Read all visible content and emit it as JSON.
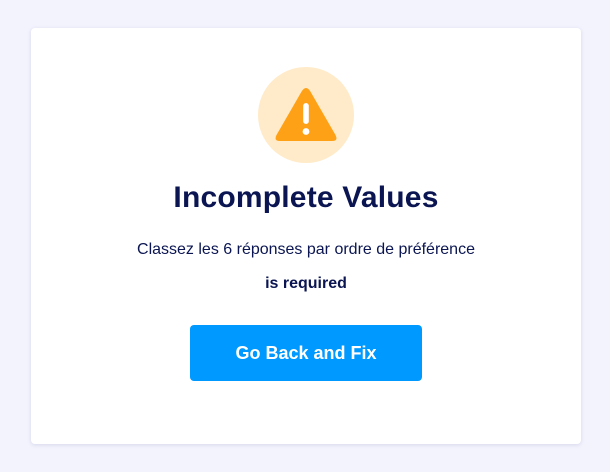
{
  "dialog": {
    "icon": "warning-triangle-icon",
    "title": "Incomplete Values",
    "field_label": "Classez les 6 réponses par ordre de préférence",
    "message": "is required",
    "button_label": "Go Back and Fix"
  },
  "colors": {
    "background": "#f3f3fe",
    "card": "#ffffff",
    "icon_circle": "#ffebc9",
    "icon_triangle": "#ffa116",
    "text": "#0a1551",
    "button": "#0099ff",
    "button_text": "#ffffff"
  }
}
